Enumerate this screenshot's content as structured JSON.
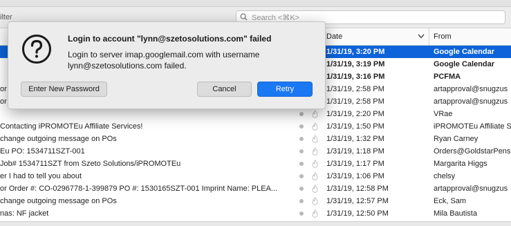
{
  "top_strip": {
    "partial_text": ""
  },
  "filter": {
    "label": "ilter",
    "search_placeholder": "Search <⌘K>"
  },
  "columns": {
    "date": "Date",
    "from": "From"
  },
  "rows": [
    {
      "subject": "",
      "date": "1/31/19, 3:20 PM",
      "from": "Google Calendar",
      "state": "selected-bold"
    },
    {
      "subject": "",
      "date": "1/31/19, 3:19 PM",
      "from": "Google Calendar",
      "state": "bold"
    },
    {
      "subject": "",
      "date": "1/31/19, 3:16 PM",
      "from": "PCFMA",
      "state": "bold"
    },
    {
      "subject": "or",
      "date": "1/31/19, 2:58 PM",
      "from": "artapproval@snugzus",
      "state": "normal"
    },
    {
      "subject": "or",
      "date": "1/31/19, 2:58 PM",
      "from": "artapproval@snugzus",
      "state": "normal"
    },
    {
      "subject": "",
      "date": "1/31/19, 2:20 PM",
      "from": "VRae",
      "state": "normal"
    },
    {
      "subject": "Contacting iPROMOTEu Affiliate Services!",
      "date": "1/31/19, 1:50 PM",
      "from": "iPROMOTEu Affiliate S",
      "state": "normal"
    },
    {
      "subject": "change outgoing message on POs",
      "date": "1/31/19, 1:32 PM",
      "from": "Ryan Carney",
      "state": "normal"
    },
    {
      "subject": "Eu PO: 1534711SZT-001",
      "date": "1/31/19, 1:18 PM",
      "from": "Orders@GoldstarPens",
      "state": "normal"
    },
    {
      "subject": "Job# 1534711SZT from Szeto Solutions/iPROMOTEu",
      "date": "1/31/19, 1:17 PM",
      "from": "Margarita Higgs",
      "state": "normal"
    },
    {
      "subject": "er I had to tell you about",
      "date": "1/31/19, 1:06 PM",
      "from": "chelsy",
      "state": "normal"
    },
    {
      "subject": "or Order #: CO-0296778-1-399879 PO #: 1530165SZT-001 Imprint Name: PLEA...",
      "date": "1/31/19, 12:58 PM",
      "from": "artapproval@snugzus",
      "state": "normal"
    },
    {
      "subject": "change outgoing message on POs",
      "date": "1/31/19, 12:57 PM",
      "from": "Eck, Sam",
      "state": "normal"
    },
    {
      "subject": "nas: NF jacket",
      "date": "1/31/19, 12:50 PM",
      "from": "Mila Bautista",
      "state": "normal"
    }
  ],
  "dialog": {
    "title": "Login to account \"lynn@szetosolutions.com\" failed",
    "message_line1": "Login to server imap.googlemail.com with username",
    "message_line2": "lynn@szetosolutions.com failed.",
    "buttons": {
      "enter_new_password": "Enter New Password",
      "cancel": "Cancel",
      "retry": "Retry"
    },
    "icon": "question-mark-icon"
  },
  "colors": {
    "selection": "#0d63d9",
    "primary_button": "#1a78f2"
  }
}
